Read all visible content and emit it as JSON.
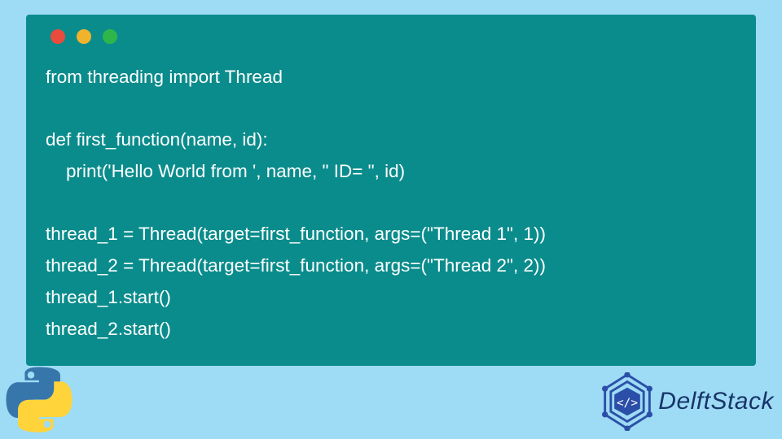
{
  "code": {
    "lines": [
      "from threading import Thread",
      "",
      "def first_function(name, id):",
      "    print('Hello World from ', name, \" ID= \", id)",
      "",
      "thread_1 = Thread(target=first_function, args=(\"Thread 1\", 1))",
      "thread_2 = Thread(target=first_function, args=(\"Thread 2\", 2))",
      "thread_1.start()",
      "thread_2.start()"
    ]
  },
  "brand": {
    "name": "DelftStack"
  },
  "colors": {
    "background": "#9edbf4",
    "window": "#0b8c8c",
    "code_text": "#ffffff",
    "brand_text": "#17356a",
    "dot_red": "#e94b3c",
    "dot_yellow": "#f1b32c",
    "dot_green": "#2fb64b"
  }
}
